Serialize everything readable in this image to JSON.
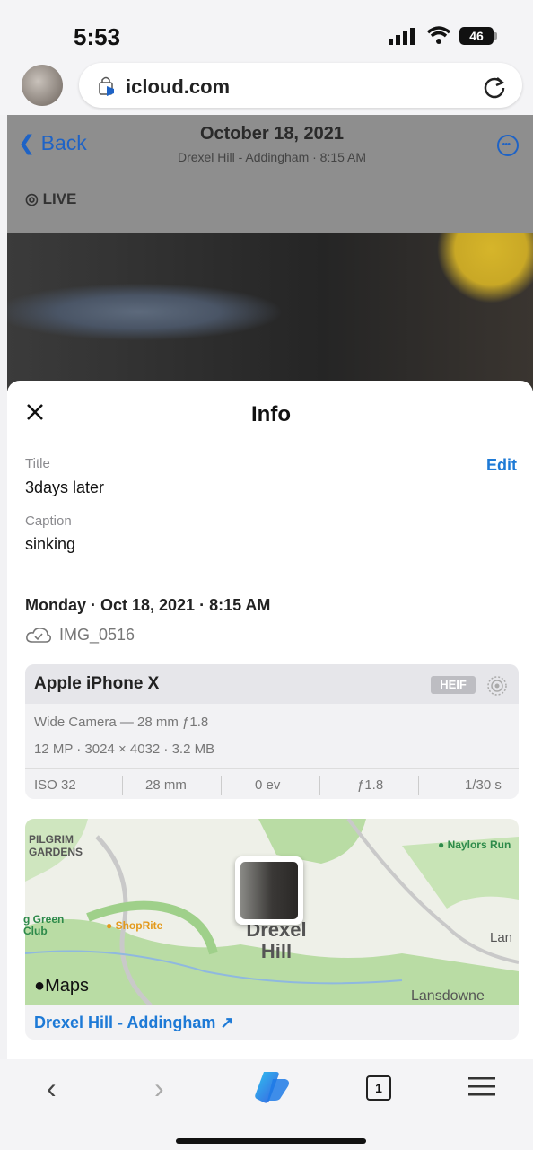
{
  "status_bar": {
    "time": "5:53",
    "battery": "46"
  },
  "browser": {
    "url": "icloud.com"
  },
  "photo_header": {
    "back_label": "Back",
    "date": "October 18, 2021",
    "subtitle": "Drexel Hill - Addingham · 8:15 AM",
    "live_label": "LIVE"
  },
  "info": {
    "heading": "Info",
    "title_label": "Title",
    "edit_label": "Edit",
    "title_value": "3days later",
    "caption_label": "Caption",
    "caption_value": "sinking",
    "datetime": "Monday · Oct 18, 2021 · 8:15 AM",
    "filename": "IMG_0516"
  },
  "device": {
    "name": "Apple iPhone X",
    "format_badge": "HEIF",
    "lens": "Wide Camera — 28 mm ƒ1.8",
    "resolution": "12 MP · 3024 × 4032 · 3.2 MB",
    "exif": {
      "iso": "ISO 32",
      "focal": "28 mm",
      "ev": "0 ev",
      "aperture": "ƒ1.8",
      "shutter": "1/30 s"
    }
  },
  "map": {
    "label_pilgrim": "PILGRIM\nGARDENS",
    "label_naylors": "Naylors Run",
    "label_green": "g Green\nClub",
    "label_shoprite": "ShopRite",
    "label_town": "Drexel\nHill",
    "label_lan": "Lan",
    "label_lansdowne": "Lansdowne",
    "brand": "Maps",
    "place_link": "Drexel Hill - Addingham ↗"
  },
  "toolbar": {
    "back": "‹",
    "forward": "›",
    "tab_count": "1"
  },
  "colors": {
    "accent": "#1e7ad6",
    "header_overlay": "#8e8e8e"
  }
}
